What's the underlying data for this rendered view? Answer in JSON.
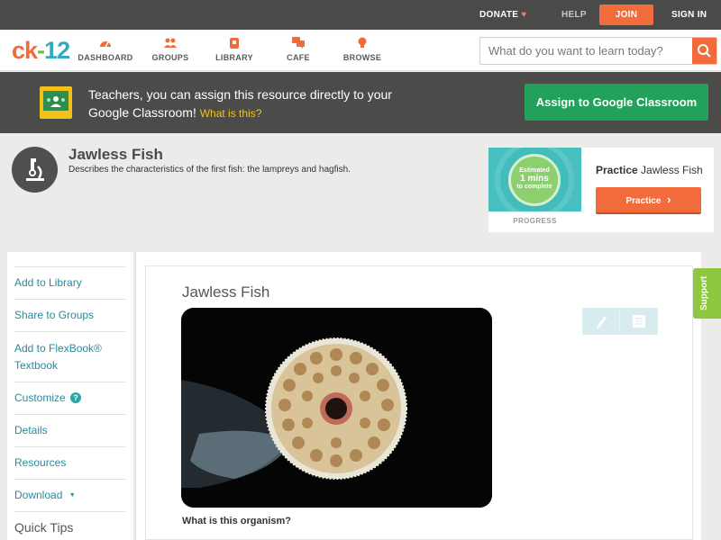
{
  "topbar": {
    "donate": "DONATE",
    "help": "HELP",
    "join": "JOIN",
    "signin": "SIGN IN"
  },
  "logo": {
    "ck": "ck",
    "dash": "-",
    "num": "12"
  },
  "nav": {
    "items": [
      {
        "label": "DASHBOARD",
        "icon": "dashboard-icon"
      },
      {
        "label": "GROUPS",
        "icon": "groups-icon"
      },
      {
        "label": "LIBRARY",
        "icon": "library-icon"
      },
      {
        "label": "CAFE",
        "icon": "cafe-icon"
      },
      {
        "label": "BROWSE",
        "icon": "browse-icon"
      }
    ]
  },
  "search": {
    "placeholder": "What do you want to learn today?"
  },
  "banner": {
    "message": "Teachers, you can assign this resource directly to your Google Classroom!",
    "what": "What is this?",
    "assign_button": "Assign to Google Classroom"
  },
  "concept": {
    "title": "Jawless Fish",
    "description": "Describes the characteristics of the first fish: the lampreys and hagfish."
  },
  "progress": {
    "estimated": "Estimated",
    "mins": "1 mins",
    "complete": "to complete",
    "label": "PROGRESS",
    "practice_bold": "Practice",
    "practice_name": "Jawless Fish",
    "practice_button": "Practice"
  },
  "sidebar": {
    "items": [
      "Add to Library",
      "Share to Groups",
      "Add to FlexBook® Textbook",
      "Customize",
      "Details",
      "Resources",
      "Download"
    ],
    "customize_badge": "?",
    "download_caret": "▼",
    "quick_tips": "Quick Tips"
  },
  "article": {
    "title": "Jawless Fish",
    "question": "What is this organism?"
  },
  "support": "Support",
  "colors": {
    "accent_orange": "#f26b3a",
    "teal_link": "#2a8a9c",
    "classroom_green": "#21a15a",
    "support_green": "#8dc63f"
  }
}
